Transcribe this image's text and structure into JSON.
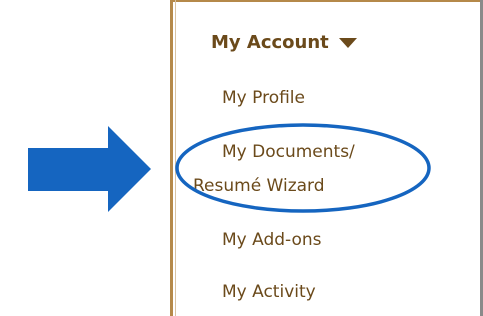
{
  "menu": {
    "header_label": "My Account",
    "items": [
      {
        "label": "My Profile"
      },
      {
        "label_line1": "My Documents/",
        "label_line2": "Resumé Wizard"
      },
      {
        "label": "My Add-ons"
      },
      {
        "label": "My Activity"
      }
    ]
  },
  "colors": {
    "text": "#6b4a1b",
    "arrow": "#1565c0",
    "ellipse": "#1565c0",
    "border": "#b5894a"
  },
  "icons": {
    "header_caret": "caret-down-icon",
    "pointer_arrow": "right-arrow-icon"
  }
}
